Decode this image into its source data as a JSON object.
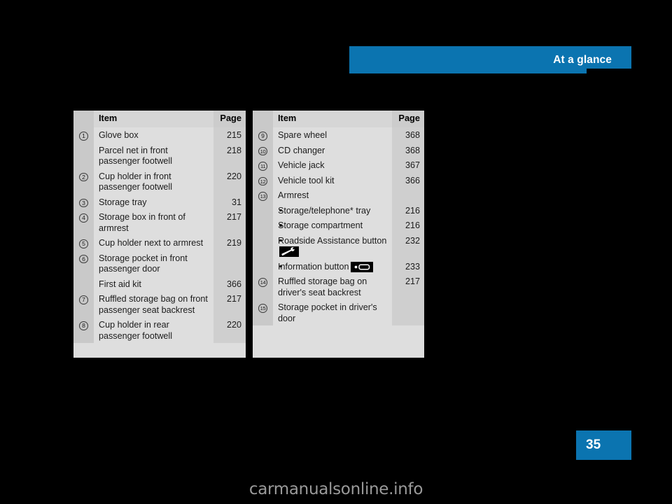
{
  "header": {
    "title": "At a glance",
    "accent_color": "#0b74b0"
  },
  "page_badge": {
    "number": "35",
    "color": "#0b74b0"
  },
  "watermark": {
    "text": "carmanualsonline.info"
  },
  "tables": {
    "left": {
      "headers": {
        "num": "",
        "item": "Item",
        "page": "Page"
      },
      "rows": [
        {
          "num": "1",
          "item": "Glove box",
          "page": "215"
        },
        {
          "num": "",
          "item": "Parcel net in front passenger footwell",
          "page": "218"
        },
        {
          "num": "2",
          "item": "Cup holder in front passenger footwell",
          "page": "220"
        },
        {
          "num": "3",
          "item": "Storage tray",
          "page": "31"
        },
        {
          "num": "4",
          "item": "Storage box in front of armrest",
          "page": "217"
        },
        {
          "num": "5",
          "item": "Cup holder next to armrest",
          "page": "219"
        },
        {
          "num": "6",
          "item": "Storage pocket in front passenger door",
          "page": ""
        },
        {
          "num": "",
          "item": "First aid kit",
          "page": "366"
        },
        {
          "num": "7",
          "item": "Ruffled storage bag on front passenger seat backrest",
          "page": "217"
        },
        {
          "num": "8",
          "item": "Cup holder in rear passenger footwell",
          "page": "220"
        }
      ]
    },
    "right": {
      "headers": {
        "num": "",
        "item": "Item",
        "page": "Page"
      },
      "rows": [
        {
          "num": "9",
          "item": "Spare wheel",
          "page": "368"
        },
        {
          "num": "10",
          "item": "CD changer",
          "page": "368"
        },
        {
          "num": "11",
          "item": "Vehicle jack",
          "page": "367"
        },
        {
          "num": "12",
          "item": "Vehicle tool kit",
          "page": "366"
        },
        {
          "num": "13",
          "item": "Armrest",
          "page": ""
        },
        {
          "num": "",
          "item": "Storage/telephone* tray",
          "page": "216",
          "bullet": true
        },
        {
          "num": "",
          "item": "Storage compartment",
          "page": "216",
          "bullet": true
        },
        {
          "num": "",
          "item": "Roadside Assistance button",
          "page": "232",
          "bullet": true,
          "icon": "wrench-button-icon"
        },
        {
          "num": "",
          "item": "Information button",
          "page": "233",
          "bullet": true,
          "icon": "information-button-icon"
        },
        {
          "num": "14",
          "item": "Ruffled storage bag on driver's seat backrest",
          "page": "217"
        },
        {
          "num": "15",
          "item": "Storage pocket in driver's door",
          "page": ""
        }
      ]
    }
  }
}
